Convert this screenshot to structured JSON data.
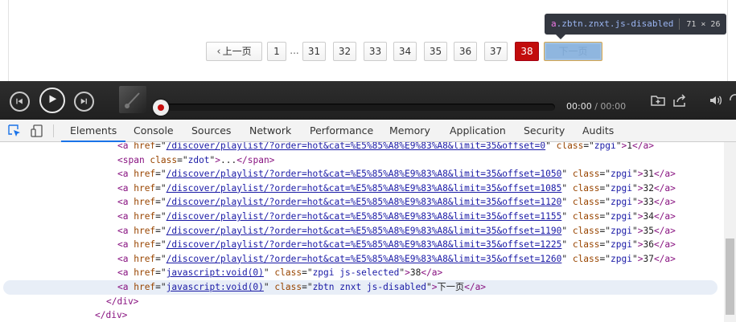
{
  "pagination": {
    "prev_label": "上一页",
    "first_page": "1",
    "ellipsis": "...",
    "pages": [
      "31",
      "32",
      "33",
      "34",
      "35",
      "36",
      "37"
    ],
    "selected_page": "38",
    "next_label": "下一页"
  },
  "inspect_tooltip": {
    "tag": "a",
    "classes": ".zbtn.znxt.js-disabled",
    "dimensions": "71 × 26"
  },
  "player": {
    "current_time": "00:00",
    "separator": " / ",
    "total_time": "00:00"
  },
  "devtools": {
    "tabs": [
      "Elements",
      "Console",
      "Sources",
      "Network",
      "Performance",
      "Memory",
      "Application",
      "Security",
      "Audits"
    ],
    "active_tab": "Elements",
    "lines": [
      {
        "indent": 146,
        "tag": "a",
        "href": "/discover/playlist/?order=hot&cat=%E5%85%A8%E9%83%A8&limit=35&offset=0",
        "cls": "zpgi",
        "text": "1"
      },
      {
        "indent": 146,
        "tag": "span",
        "href": "",
        "cls": "zdot",
        "text": "..."
      },
      {
        "indent": 146,
        "tag": "a",
        "href": "/discover/playlist/?order=hot&cat=%E5%85%A8%E9%83%A8&limit=35&offset=1050",
        "cls": "zpgi",
        "text": "31"
      },
      {
        "indent": 146,
        "tag": "a",
        "href": "/discover/playlist/?order=hot&cat=%E5%85%A8%E9%83%A8&limit=35&offset=1085",
        "cls": "zpgi",
        "text": "32"
      },
      {
        "indent": 146,
        "tag": "a",
        "href": "/discover/playlist/?order=hot&cat=%E5%85%A8%E9%83%A8&limit=35&offset=1120",
        "cls": "zpgi",
        "text": "33"
      },
      {
        "indent": 146,
        "tag": "a",
        "href": "/discover/playlist/?order=hot&cat=%E5%85%A8%E9%83%A8&limit=35&offset=1155",
        "cls": "zpgi",
        "text": "34"
      },
      {
        "indent": 146,
        "tag": "a",
        "href": "/discover/playlist/?order=hot&cat=%E5%85%A8%E9%83%A8&limit=35&offset=1190",
        "cls": "zpgi",
        "text": "35"
      },
      {
        "indent": 146,
        "tag": "a",
        "href": "/discover/playlist/?order=hot&cat=%E5%85%A8%E9%83%A8&limit=35&offset=1225",
        "cls": "zpgi",
        "text": "36"
      },
      {
        "indent": 146,
        "tag": "a",
        "href": "/discover/playlist/?order=hot&cat=%E5%85%A8%E9%83%A8&limit=35&offset=1260",
        "cls": "zpgi",
        "text": "37"
      },
      {
        "indent": 146,
        "tag": "a",
        "href": "javascript:void(0)",
        "cls": "zpgi js-selected",
        "text": "38"
      },
      {
        "indent": 146,
        "tag": "a",
        "href": "javascript:void(0)",
        "cls": "zbtn znxt js-disabled",
        "text": "下一页",
        "highlight": true
      },
      {
        "indent": 132,
        "close": "div"
      },
      {
        "indent": 118,
        "close": "div"
      }
    ]
  }
}
